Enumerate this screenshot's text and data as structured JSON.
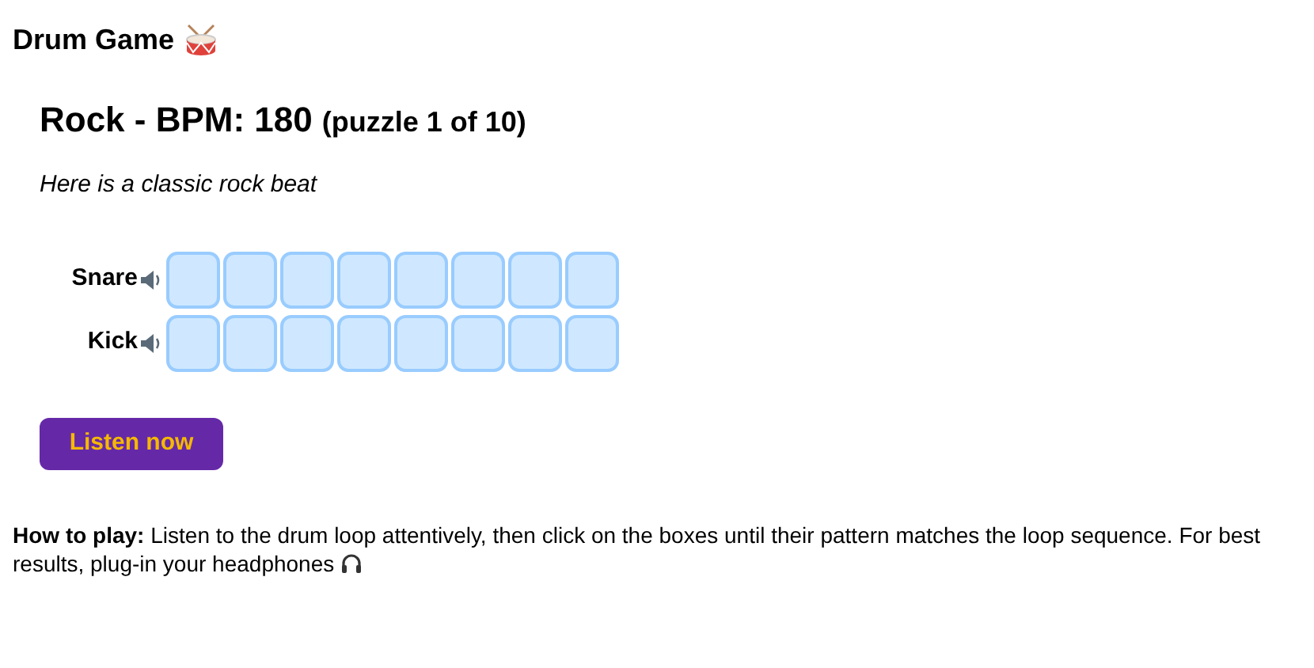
{
  "app_title": "Drum Game",
  "heading": {
    "title": "Rock - BPM: 180",
    "subtitle": "(puzzle 1 of 10)"
  },
  "description": "Here is a classic rock beat",
  "tracks": [
    {
      "name": "Snare",
      "cells": [
        {
          "on": false
        },
        {
          "on": false
        },
        {
          "on": false
        },
        {
          "on": false
        },
        {
          "on": false
        },
        {
          "on": false
        },
        {
          "on": false
        },
        {
          "on": false
        }
      ]
    },
    {
      "name": "Kick",
      "cells": [
        {
          "on": false
        },
        {
          "on": false
        },
        {
          "on": false
        },
        {
          "on": false
        },
        {
          "on": false
        },
        {
          "on": false
        },
        {
          "on": false
        },
        {
          "on": false
        }
      ]
    }
  ],
  "listen_button": "Listen now",
  "instructions": "**How to play:** Listen to the drum loop attentively, then click on the boxes until their pattern matches the loop sequence. For best results, plug-in your headphones"
}
